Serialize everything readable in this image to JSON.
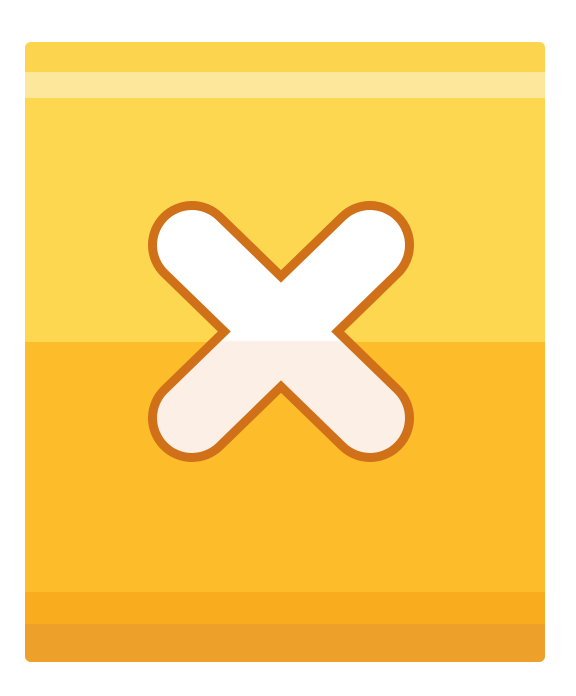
{
  "icon": {
    "name": "close-x-icon",
    "colors": {
      "background": "#ffffff",
      "top_half": "#fdd74f",
      "bottom_half": "#fdbd2a",
      "top_edge": "#fdd44d",
      "highlight_band": "#fde79a",
      "bottom_band": "#f9ac1e",
      "bottom_edge": "#eea12a",
      "x_fill": "#ffffff",
      "x_outline": "#d07018"
    }
  }
}
